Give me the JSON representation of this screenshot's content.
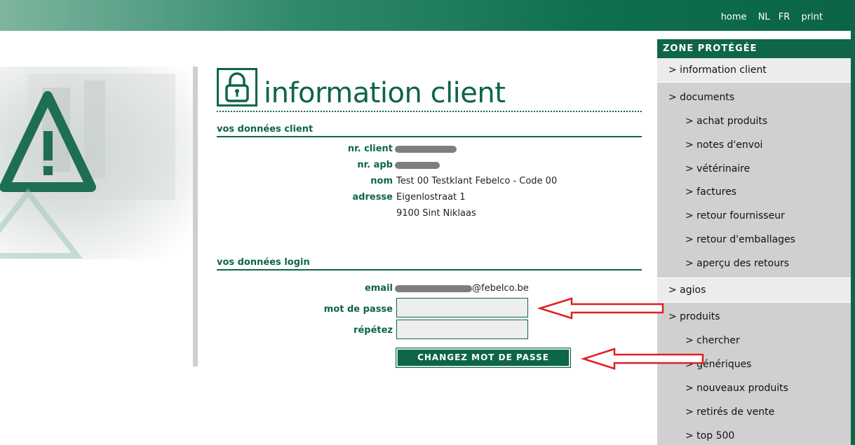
{
  "topnav": {
    "home": "home",
    "nl": "NL",
    "fr": "FR",
    "print": "print"
  },
  "page": {
    "title": "information client"
  },
  "client_section": {
    "heading": "vos données client",
    "client_nr_label": "nr. client",
    "apb_nr_label": "nr. apb",
    "name_label": "nom",
    "name_value": "Test 00 Testklant Febelco - Code 00",
    "address_label": "adresse",
    "address_line1": "Eigenlostraat 1",
    "address_line2": "9100 Sint Niklaas"
  },
  "login_section": {
    "heading": "vos données login",
    "email_label": "email",
    "email_suffix": "@febelco.be",
    "password_label": "mot de passe",
    "repeat_label": "répétez",
    "change_button": "CHANGEZ MOT DE PASSE"
  },
  "sidebar": {
    "header": "ZONE PROTÉGÉE",
    "items": [
      {
        "label": "> information client"
      },
      {
        "label": "> documents"
      },
      {
        "label": "> achat produits"
      },
      {
        "label": "> notes d'envoi"
      },
      {
        "label": "> vétérinaire"
      },
      {
        "label": "> factures"
      },
      {
        "label": "> retour fournisseur"
      },
      {
        "label": "> retour d'emballages"
      },
      {
        "label": "> aperçu des retours"
      },
      {
        "label": "> agios"
      },
      {
        "label": "> produits"
      },
      {
        "label": "> chercher"
      },
      {
        "label": "> génériques"
      },
      {
        "label": "> nouveaux produits"
      },
      {
        "label": "> retirés de vente"
      },
      {
        "label": "> top 500"
      }
    ]
  },
  "colors": {
    "brand_green": "#0e6548",
    "sidebar_grey": "#d0d0d0",
    "annotation_red": "#e02020"
  },
  "icons": {
    "title_icon": "padlock-icon",
    "warning_icon": "warning-triangle-icon"
  }
}
